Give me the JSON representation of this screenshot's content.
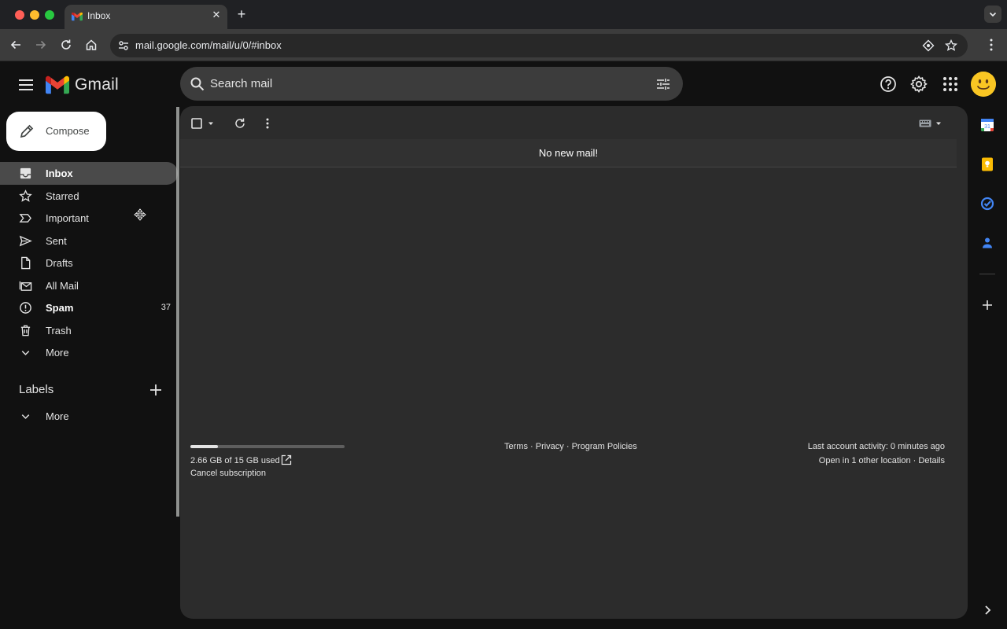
{
  "browser": {
    "tab_title": "Inbox",
    "url": "mail.google.com/mail/u/0/#inbox"
  },
  "header": {
    "app_name": "Gmail",
    "search_placeholder": "Search mail"
  },
  "sidebar": {
    "compose_label": "Compose",
    "items": [
      {
        "label": "Inbox",
        "icon": "inbox-icon",
        "active": true
      },
      {
        "label": "Starred",
        "icon": "star-icon"
      },
      {
        "label": "Important",
        "icon": "important-icon"
      },
      {
        "label": "Sent",
        "icon": "sent-icon"
      },
      {
        "label": "Drafts",
        "icon": "draft-icon"
      },
      {
        "label": "All Mail",
        "icon": "all-mail-icon"
      },
      {
        "label": "Spam",
        "icon": "spam-icon",
        "count": "37",
        "bold": true
      },
      {
        "label": "Trash",
        "icon": "trash-icon"
      },
      {
        "label": "More",
        "icon": "chevron-down-icon"
      }
    ],
    "labels_title": "Labels",
    "labels_more": "More"
  },
  "main": {
    "empty_message": "No new mail!",
    "storage_used_fraction": 0.177,
    "storage_text": "2.66 GB of 15 GB used",
    "cancel_subscription": "Cancel subscription",
    "footer": {
      "terms": "Terms",
      "privacy": "Privacy",
      "policies": "Program Policies",
      "separator": " · "
    },
    "activity": {
      "last_activity": "Last account activity: 0 minutes ago",
      "open_in": "Open in 1 other location",
      "details": "Details"
    }
  },
  "colors": {
    "page_bg": "#111111",
    "panel_bg": "#2c2c2c",
    "compose_bg": "#ffffff",
    "active_nav_bg": "#4a4a4a"
  }
}
